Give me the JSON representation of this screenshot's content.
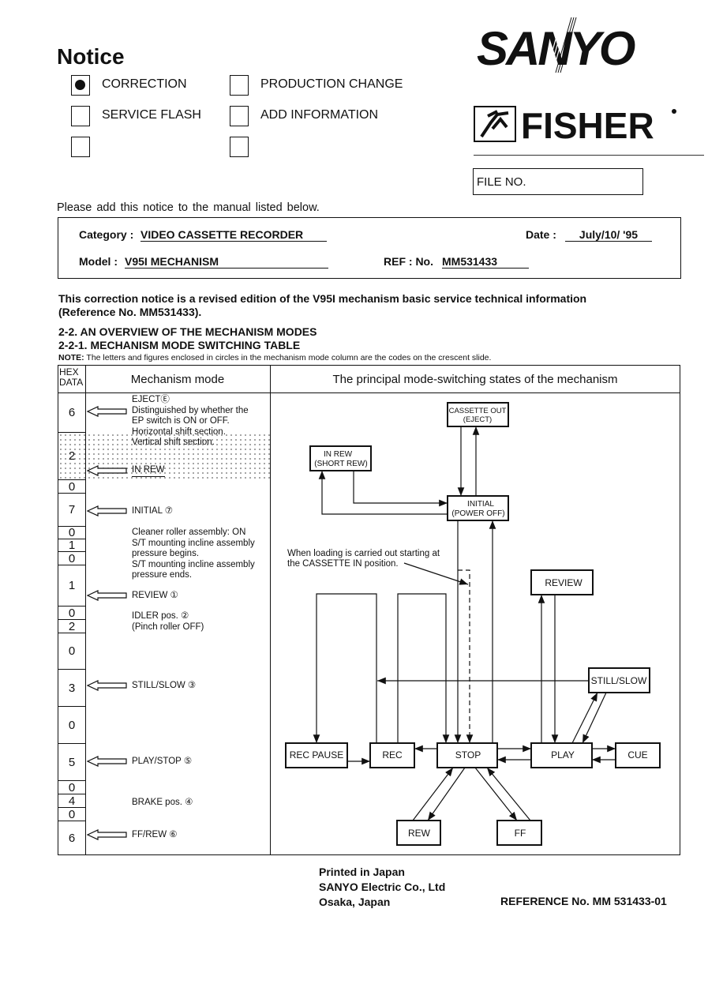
{
  "header": {
    "title": "Notice",
    "checkboxes": [
      {
        "label": "CORRECTION",
        "checked": true
      },
      {
        "label": "PRODUCTION CHANGE",
        "checked": false
      },
      {
        "label": "SERVICE FLASH",
        "checked": false
      },
      {
        "label": "ADD INFORMATION",
        "checked": false
      },
      {
        "label": "",
        "checked": false
      },
      {
        "label": "",
        "checked": false
      }
    ],
    "logos": {
      "sanyo": "SANYO",
      "fisher": "FISHER"
    },
    "file_no_label": "FILE NO.",
    "instruction": "Please add this notice to the manual listed below."
  },
  "info_box": {
    "category_label": "Category :",
    "category_value": "VIDEO CASSETTE RECORDER",
    "date_label": "Date :",
    "date_value": "July/10/ '95",
    "model_label": "Model :",
    "model_value": "V95I MECHANISM",
    "ref_label": "REF : No.",
    "ref_value": "MM531433"
  },
  "intro": {
    "line1": "This correction notice is a revised edition of the V95I mechanism basic service technical information",
    "line2": "(Reference No. MM531433)."
  },
  "section": {
    "heading1": "2-2. AN OVERVIEW OF THE MECHANISM MODES",
    "heading2": "2-2-1. MECHANISM MODE SWITCHING TABLE",
    "note_label": "NOTE:",
    "note_text": "The letters and figures enclosed in circles in the mechanism mode column are the codes on the crescent slide."
  },
  "table": {
    "col_hex_line1": "HEX",
    "col_hex_line2": "DATA",
    "col_mode": "Mechanism mode",
    "col_states": "The principal mode-switching states of the mechanism",
    "hex_values": [
      "6",
      "2",
      "0",
      "7",
      "0",
      "1",
      "0",
      "1",
      "0",
      "2",
      "0",
      "3",
      "0",
      "5",
      "0",
      "4",
      "0",
      "6"
    ],
    "mode_texts": {
      "eject": "EJECTⒺ",
      "eject_desc": [
        "Distinguished by whether the",
        "EP switch is ON or OFF.",
        "Horizontal shift section.",
        "Vertical shift section."
      ],
      "in_rew": "IN REW",
      "initial": "INITIAL ⑦",
      "review_desc": [
        "Cleaner roller assembly: ON",
        "S/T mounting incline assembly",
        "pressure begins.",
        "S/T mounting incline assembly",
        "pressure ends."
      ],
      "review": "REVIEW ①",
      "idler": [
        "IDLER pos. ②",
        "(Pinch roller OFF)"
      ],
      "still_slow": "STILL/SLOW ③",
      "play_stop": "PLAY/STOP ⑤",
      "brake": "BRAKE pos. ④",
      "ff_rew": "FF/REW ⑥"
    }
  },
  "diagram": {
    "cassette_out": [
      "CASSETTE OUT",
      "(EJECT)"
    ],
    "in_rew": [
      "IN REW",
      "(SHORT REW)"
    ],
    "initial": [
      "INITIAL",
      "(POWER OFF)"
    ],
    "annotation": [
      "When loading is carried out starting at",
      "the CASSETTE IN position."
    ],
    "review": "REVIEW",
    "still_slow": "STILL/SLOW",
    "rec_pause": "REC PAUSE",
    "rec": "REC",
    "stop": "STOP",
    "play": "PLAY",
    "cue": "CUE",
    "rew": "REW",
    "ff": "FF"
  },
  "footer": {
    "lines": [
      "Printed in Japan",
      "SANYO Electric Co., Ltd",
      "Osaka, Japan"
    ],
    "reference": "REFERENCE No. MM 531433-01"
  }
}
